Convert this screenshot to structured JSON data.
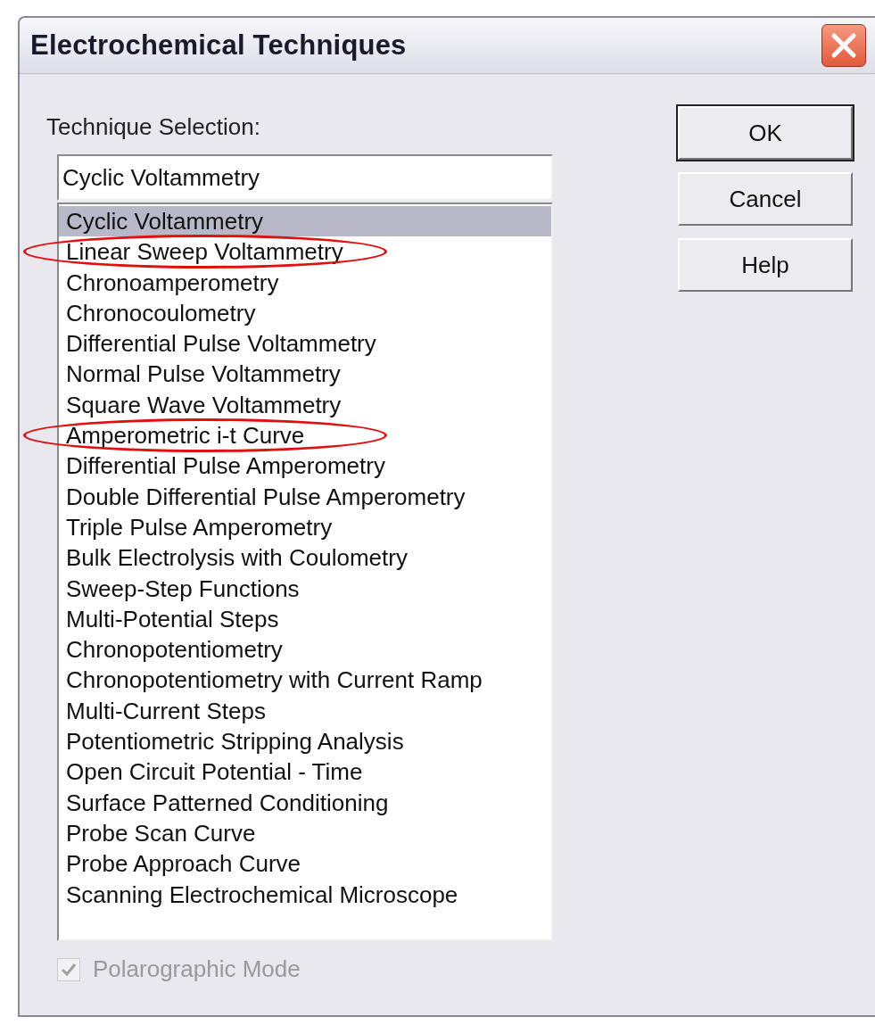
{
  "window": {
    "title": "Electrochemical Techniques"
  },
  "technique_selection": {
    "label": "Technique Selection:",
    "value": "Cyclic Voltammetry"
  },
  "list": [
    {
      "label": "Cyclic Voltammetry",
      "selected": true,
      "circled": false
    },
    {
      "label": "Linear Sweep Voltammetry",
      "selected": false,
      "circled": true
    },
    {
      "label": "Chronoamperometry",
      "selected": false,
      "circled": false
    },
    {
      "label": "Chronocoulometry",
      "selected": false,
      "circled": false
    },
    {
      "label": "Differential Pulse Voltammetry",
      "selected": false,
      "circled": false
    },
    {
      "label": "Normal Pulse Voltammetry",
      "selected": false,
      "circled": false
    },
    {
      "label": "Square Wave Voltammetry",
      "selected": false,
      "circled": false
    },
    {
      "label": "Amperometric i-t Curve",
      "selected": false,
      "circled": true
    },
    {
      "label": "Differential Pulse Amperometry",
      "selected": false,
      "circled": false
    },
    {
      "label": "Double Differential Pulse Amperometry",
      "selected": false,
      "circled": false
    },
    {
      "label": "Triple Pulse Amperometry",
      "selected": false,
      "circled": false
    },
    {
      "label": "Bulk Electrolysis with Coulometry",
      "selected": false,
      "circled": false
    },
    {
      "label": "Sweep-Step Functions",
      "selected": false,
      "circled": false
    },
    {
      "label": "Multi-Potential Steps",
      "selected": false,
      "circled": false
    },
    {
      "label": "Chronopotentiometry",
      "selected": false,
      "circled": false
    },
    {
      "label": "Chronopotentiometry with Current Ramp",
      "selected": false,
      "circled": false
    },
    {
      "label": "Multi-Current Steps",
      "selected": false,
      "circled": false
    },
    {
      "label": "Potentiometric Stripping Analysis",
      "selected": false,
      "circled": false
    },
    {
      "label": "Open Circuit Potential - Time",
      "selected": false,
      "circled": false
    },
    {
      "label": "Surface Patterned Conditioning",
      "selected": false,
      "circled": false
    },
    {
      "label": "Probe Scan Curve",
      "selected": false,
      "circled": false
    },
    {
      "label": "Probe Approach Curve",
      "selected": false,
      "circled": false
    },
    {
      "label": "Scanning Electrochemical Microscope",
      "selected": false,
      "circled": false
    }
  ],
  "polarographic_mode": {
    "label": "Polarographic Mode",
    "checked": true,
    "disabled": true
  },
  "buttons": [
    {
      "label": "OK",
      "default": true
    },
    {
      "label": "Cancel",
      "default": false
    },
    {
      "label": "Help",
      "default": false
    }
  ]
}
